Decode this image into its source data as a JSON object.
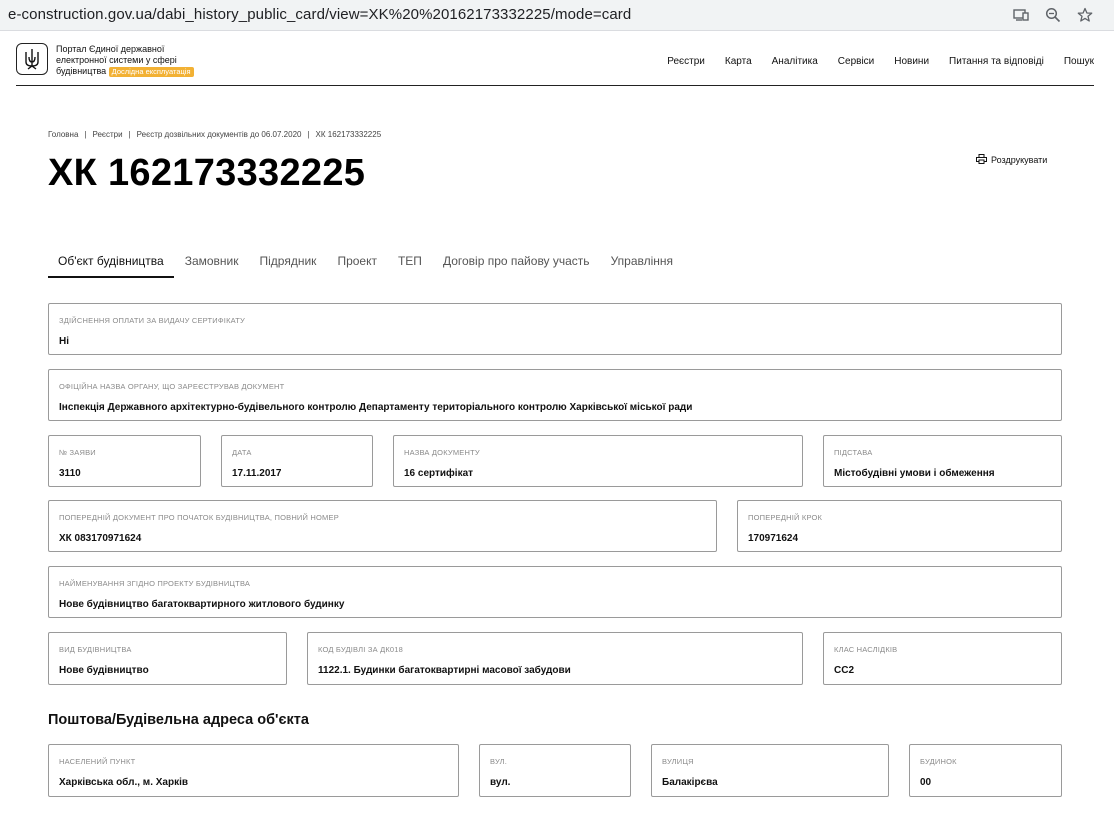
{
  "browser": {
    "url": "e-construction.gov.ua/dabi_history_public_card/view=XK%20%20162173332225/mode=card",
    "icons": [
      "install-app-icon",
      "zoom-icon",
      "bookmark-star-icon"
    ]
  },
  "header": {
    "logo_line1": "Портал Єдиної державної",
    "logo_line2": "електронної системи у сфері",
    "logo_line3": "будівництва",
    "beta_badge": "Дослідна експлуатація",
    "badge_color": "#f2b134",
    "nav": [
      "Реєстри",
      "Карта",
      "Аналітика",
      "Сервіси",
      "Новини",
      "Питання та відповіді",
      "Пошук"
    ]
  },
  "breadcrumb": [
    "Головна",
    "Реєстри",
    "Реєстр дозвільних документів до 06.07.2020",
    "ХК 162173332225"
  ],
  "title": "ХК 162173332225",
  "print_label": "Роздрукувати",
  "tabs": [
    "Об'єкт будівництва",
    "Замовник",
    "Підрядник",
    "Проект",
    "ТЕП",
    "Договір про пайову участь",
    "Управління"
  ],
  "fields": {
    "payment": {
      "label": "Здійснення оплати за видачу сертифікату",
      "value": "Ні"
    },
    "authority": {
      "label": "Офіційна назва органу, що зареєстрував документ",
      "value": "Інспекція Державного архітектурно-будівельного контролю Департаменту територіального контролю Харківської міської ради"
    },
    "application_no": {
      "label": "№ заяви",
      "value": "3110"
    },
    "date": {
      "label": "Дата",
      "value": "17.11.2017"
    },
    "doc_name": {
      "label": "Назва документу",
      "value": "16 сертифікат"
    },
    "basis": {
      "label": "Підстава",
      "value": "Містобудівні умови і обмеження"
    },
    "prev_doc": {
      "label": "Попередній документ про початок будівництва, повний номер",
      "value": "ХК 083170971624"
    },
    "prev_step": {
      "label": "Попередній крок",
      "value": "170971624"
    },
    "project_name": {
      "label": "Найменування згідно проекту будівництва",
      "value": "Нове будівництво багатоквартирного житлового будинку"
    },
    "construction_type": {
      "label": "Вид будівництва",
      "value": "Нове будівництво"
    },
    "building_code": {
      "label": "Код будівлі за ДК018",
      "value": "1122.1. Будинки багатоквартирні масової забудови"
    },
    "consequence_class": {
      "label": "Клас наслідків",
      "value": "СС2"
    },
    "settlement": {
      "label": "Населений пункт",
      "value": "Харківська обл., м. Харків"
    },
    "street_type": {
      "label": "Вул.",
      "value": "вул."
    },
    "street": {
      "label": "Вулиця",
      "value": "Балакірєва"
    },
    "building": {
      "label": "Будинок",
      "value": "00"
    }
  },
  "address_section_title": "Поштова/Будівельна адреса об'єкта"
}
